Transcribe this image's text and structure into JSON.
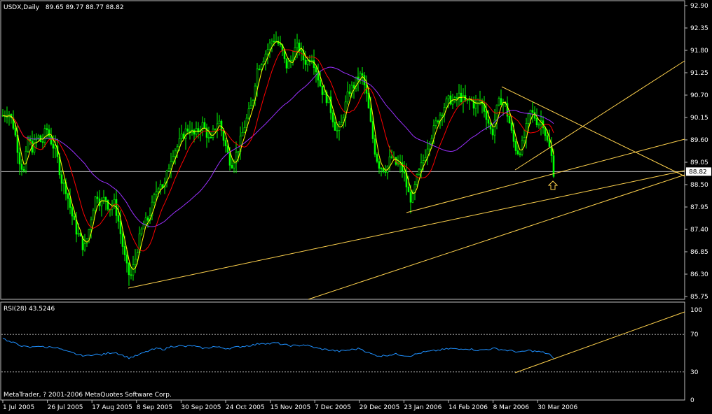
{
  "header": {
    "symbol": "USDX,Daily",
    "ohlc": "89.65 89.77 88.77 88.82"
  },
  "indicator": {
    "label": "RSI(28) 43.5246",
    "levels": [
      30,
      70
    ],
    "ylim": [
      0,
      100
    ],
    "tick_labels": [
      "100",
      "70",
      "30",
      "0"
    ]
  },
  "copyright": "MetaTrader, ? 2001-2006 MetaQuotes Software Corp.",
  "colors": {
    "background": "#000000",
    "frame": "#c0c0c0",
    "candles": "#00ff00",
    "ma_fast": "#ffff00",
    "ma_mid": "#ff0000",
    "ma_slow": "#9b30ff",
    "rsi": "#1e90ff",
    "trendlines": "#ffd24d",
    "current_price_line": "#c0c0c0",
    "arrow": "#ffd24d"
  },
  "chart_data": [
    {
      "type": "candlestick",
      "ylim": [
        85.75,
        92.9
      ],
      "y_ticks": [
        "92.90",
        "92.35",
        "91.80",
        "91.25",
        "90.70",
        "90.15",
        "89.60",
        "89.05",
        "88.50",
        "87.95",
        "87.40",
        "86.85",
        "86.30",
        "85.75"
      ],
      "current_price": "88.82",
      "x_ticks": [
        "1 Jul 2005",
        "26 Jul 2005",
        "17 Aug 2005",
        "8 Sep 2005",
        "30 Sep 2005",
        "24 Oct 2005",
        "15 Nov 2005",
        "7 Dec 2005",
        "29 Dec 2005",
        "23 Jan 2006",
        "14 Feb 2006",
        "8 Mar 2006",
        "30 Mar 2006"
      ],
      "close_path": [
        [
          0,
          90.2
        ],
        [
          8,
          90.3
        ],
        [
          16,
          89.9
        ],
        [
          24,
          89.1
        ],
        [
          30,
          88.8
        ],
        [
          36,
          89.6
        ],
        [
          42,
          89.4
        ],
        [
          50,
          89.7
        ],
        [
          56,
          89.5
        ],
        [
          62,
          89.9
        ],
        [
          68,
          89.6
        ],
        [
          76,
          89.3
        ],
        [
          84,
          88.6
        ],
        [
          90,
          88.4
        ],
        [
          98,
          87.8
        ],
        [
          104,
          87.4
        ],
        [
          110,
          87.2
        ],
        [
          116,
          86.9
        ],
        [
          122,
          87.3
        ],
        [
          128,
          87.9
        ],
        [
          134,
          88.3
        ],
        [
          140,
          88.0
        ],
        [
          146,
          88.2
        ],
        [
          152,
          87.9
        ],
        [
          158,
          88.1
        ],
        [
          164,
          87.7
        ],
        [
          170,
          87.1
        ],
        [
          176,
          86.5
        ],
        [
          182,
          86.2
        ],
        [
          188,
          86.6
        ],
        [
          194,
          87.1
        ],
        [
          200,
          87.5
        ],
        [
          206,
          87.6
        ],
        [
          212,
          87.9
        ],
        [
          218,
          88.3
        ],
        [
          224,
          88.6
        ],
        [
          230,
          88.4
        ],
        [
          236,
          88.9
        ],
        [
          242,
          89.3
        ],
        [
          248,
          89.4
        ],
        [
          254,
          89.6
        ],
        [
          260,
          89.8
        ],
        [
          266,
          89.9
        ],
        [
          272,
          89.7
        ],
        [
          278,
          89.8
        ],
        [
          284,
          90.0
        ],
        [
          290,
          89.8
        ],
        [
          296,
          89.5
        ],
        [
          302,
          89.9
        ],
        [
          308,
          90.1
        ],
        [
          314,
          89.7
        ],
        [
          320,
          89.3
        ],
        [
          326,
          89.0
        ],
        [
          332,
          89.2
        ],
        [
          338,
          89.5
        ],
        [
          344,
          89.9
        ],
        [
          350,
          90.2
        ],
        [
          356,
          90.5
        ],
        [
          362,
          91.3
        ],
        [
          368,
          91.5
        ],
        [
          374,
          91.7
        ],
        [
          380,
          91.9
        ],
        [
          386,
          92.1
        ],
        [
          392,
          92.0
        ],
        [
          398,
          91.8
        ],
        [
          404,
          91.4
        ],
        [
          410,
          91.5
        ],
        [
          416,
          91.8
        ],
        [
          422,
          91.9
        ],
        [
          428,
          91.6
        ],
        [
          434,
          91.5
        ],
        [
          440,
          91.7
        ],
        [
          446,
          91.4
        ],
        [
          452,
          91.0
        ],
        [
          458,
          90.7
        ],
        [
          464,
          90.6
        ],
        [
          470,
          90.2
        ],
        [
          476,
          89.8
        ],
        [
          482,
          89.9
        ],
        [
          488,
          90.4
        ],
        [
          494,
          90.8
        ],
        [
          500,
          90.9
        ],
        [
          506,
          91.1
        ],
        [
          512,
          91.2
        ],
        [
          518,
          90.8
        ],
        [
          524,
          90.1
        ],
        [
          530,
          89.4
        ],
        [
          536,
          89.0
        ],
        [
          542,
          88.9
        ],
        [
          548,
          88.9
        ],
        [
          554,
          89.2
        ],
        [
          560,
          89.0
        ],
        [
          566,
          89.0
        ],
        [
          572,
          88.8
        ],
        [
          578,
          88.3
        ],
        [
          584,
          88.1
        ],
        [
          590,
          88.6
        ],
        [
          596,
          88.9
        ],
        [
          602,
          89.2
        ],
        [
          608,
          89.6
        ],
        [
          614,
          89.8
        ],
        [
          620,
          90.1
        ],
        [
          626,
          90.3
        ],
        [
          632,
          90.5
        ],
        [
          638,
          90.6
        ],
        [
          644,
          90.5
        ],
        [
          650,
          90.7
        ],
        [
          656,
          90.6
        ],
        [
          662,
          90.5
        ],
        [
          668,
          90.6
        ],
        [
          674,
          90.4
        ],
        [
          680,
          90.6
        ],
        [
          686,
          90.4
        ],
        [
          692,
          90.1
        ],
        [
          698,
          89.7
        ],
        [
          704,
          90.3
        ],
        [
          710,
          90.6
        ],
        [
          716,
          90.5
        ],
        [
          722,
          90.1
        ],
        [
          728,
          89.6
        ],
        [
          734,
          89.3
        ],
        [
          740,
          89.4
        ],
        [
          746,
          89.8
        ],
        [
          752,
          90.3
        ],
        [
          758,
          90.2
        ],
        [
          764,
          90.0
        ],
        [
          770,
          90.1
        ],
        [
          776,
          89.6
        ],
        [
          782,
          89.3
        ],
        [
          786,
          88.82
        ]
      ]
    },
    {
      "type": "line",
      "name": "RSI(28)",
      "ylim": [
        0,
        100
      ],
      "values_path": [
        [
          0,
          66
        ],
        [
          10,
          62
        ],
        [
          20,
          60
        ],
        [
          30,
          57
        ],
        [
          40,
          56
        ],
        [
          50,
          58
        ],
        [
          60,
          56
        ],
        [
          70,
          57
        ],
        [
          80,
          55
        ],
        [
          90,
          52
        ],
        [
          100,
          50
        ],
        [
          110,
          48
        ],
        [
          120,
          47
        ],
        [
          130,
          49
        ],
        [
          140,
          48
        ],
        [
          150,
          50
        ],
        [
          160,
          51
        ],
        [
          170,
          48
        ],
        [
          180,
          45
        ],
        [
          190,
          47
        ],
        [
          200,
          50
        ],
        [
          210,
          53
        ],
        [
          220,
          55
        ],
        [
          230,
          54
        ],
        [
          240,
          57
        ],
        [
          250,
          58
        ],
        [
          260,
          57
        ],
        [
          270,
          58
        ],
        [
          280,
          56
        ],
        [
          290,
          55
        ],
        [
          300,
          57
        ],
        [
          310,
          56
        ],
        [
          320,
          55
        ],
        [
          330,
          56
        ],
        [
          340,
          57
        ],
        [
          350,
          58
        ],
        [
          360,
          59
        ],
        [
          370,
          61
        ],
        [
          380,
          60
        ],
        [
          390,
          61
        ],
        [
          400,
          59
        ],
        [
          410,
          58
        ],
        [
          420,
          58
        ],
        [
          430,
          59
        ],
        [
          440,
          57
        ],
        [
          450,
          55
        ],
        [
          460,
          54
        ],
        [
          470,
          53
        ],
        [
          480,
          52
        ],
        [
          490,
          53
        ],
        [
          500,
          54
        ],
        [
          510,
          55
        ],
        [
          520,
          51
        ],
        [
          530,
          48
        ],
        [
          540,
          47
        ],
        [
          550,
          48
        ],
        [
          560,
          49
        ],
        [
          570,
          48
        ],
        [
          580,
          47
        ],
        [
          590,
          49
        ],
        [
          600,
          51
        ],
        [
          610,
          52
        ],
        [
          620,
          53
        ],
        [
          630,
          54
        ],
        [
          640,
          55
        ],
        [
          650,
          54
        ],
        [
          660,
          55
        ],
        [
          670,
          54
        ],
        [
          680,
          53
        ],
        [
          690,
          54
        ],
        [
          700,
          55
        ],
        [
          710,
          54
        ],
        [
          720,
          53
        ],
        [
          730,
          52
        ],
        [
          740,
          51
        ],
        [
          750,
          53
        ],
        [
          760,
          52
        ],
        [
          770,
          51
        ],
        [
          780,
          49
        ],
        [
          786,
          43.5
        ]
      ]
    }
  ]
}
